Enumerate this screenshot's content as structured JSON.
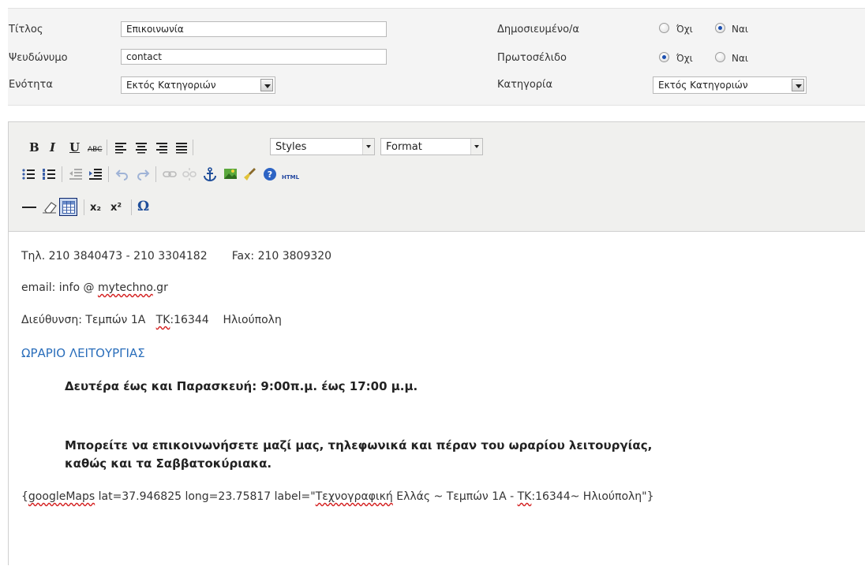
{
  "form": {
    "title_label": "Τίτλος",
    "title_value": "Επικοινωνία",
    "alias_label": "Ψευδώνυμο",
    "alias_value": "contact",
    "section_label": "Ενότητα",
    "section_value": "Εκτός Κατηγοριών",
    "published_label": "Δημοσιευμένο/α",
    "published_no": "Όχι",
    "published_yes": "Ναι",
    "published_selected": "Ναι",
    "frontpage_label": "Πρωτοσέλιδο",
    "frontpage_no": "Όχι",
    "frontpage_yes": "Ναι",
    "frontpage_selected": "Όχι",
    "category_label": "Κατηγορία",
    "category_value": "Εκτός Κατηγοριών"
  },
  "toolbar": {
    "bold": "B",
    "italic": "I",
    "underline": "U",
    "strike": "ABC",
    "styles_value": "Styles",
    "format_value": "Format",
    "html_label": "HTML",
    "subscript": "x₂",
    "superscript": "x²",
    "special_char": "Ω",
    "icons": [
      "bold-icon",
      "italic-icon",
      "underline-icon",
      "strikethrough-icon",
      "align-left-icon",
      "align-center-icon",
      "align-right-icon",
      "align-justify-icon",
      "bullet-list-icon",
      "numbered-list-icon",
      "outdent-icon",
      "indent-icon",
      "undo-icon",
      "redo-icon",
      "link-icon",
      "unlink-icon",
      "anchor-icon",
      "image-icon",
      "cleanup-icon",
      "help-icon",
      "html-icon",
      "horizontal-rule-icon",
      "eraser-icon",
      "table-icon",
      "subscript-icon",
      "superscript-icon",
      "omega-icon"
    ]
  },
  "content": {
    "phone_line": "Τηλ. 210 3840473 - 210 3304182",
    "fax_line": "Fax: 210 3809320",
    "email_prefix": "email: info @ ",
    "email_domain_word": "mytechno",
    "email_suffix": ".gr",
    "address_prefix": "Διεύθυνση: Τεμπών 1Α   ",
    "address_tk": "ΤΚ",
    "address_suffix": ":16344    Ηλιούπολη",
    "hours_heading": "ΩΡΑΡΙΟ ΛΕΙΤΟΥΡΓΙΑΣ",
    "hours_text": "Δευτέρα έως και Παρασκευή: 9:00π.μ. έως 17:00 μ.μ.",
    "contact_text_1": "Μπορείτε να επικοινωνήσετε μαζί μας, τηλεφωνικά και πέραν του ωραρίου λειτουργίας,",
    "contact_text_2": "καθώς και τα Σαββατοκύριακα.",
    "map_open": "{",
    "map_word": "googleMaps",
    "map_mid1": " lat=37.946825 long=23.75817 label=\"",
    "map_word2": "Τεχνογραφική",
    "map_mid2": " Ελλάς ~ Τεμπών 1Α - ",
    "map_tk": "ΤΚ",
    "map_end": ":16344~ Ηλιούπολη\"}"
  }
}
